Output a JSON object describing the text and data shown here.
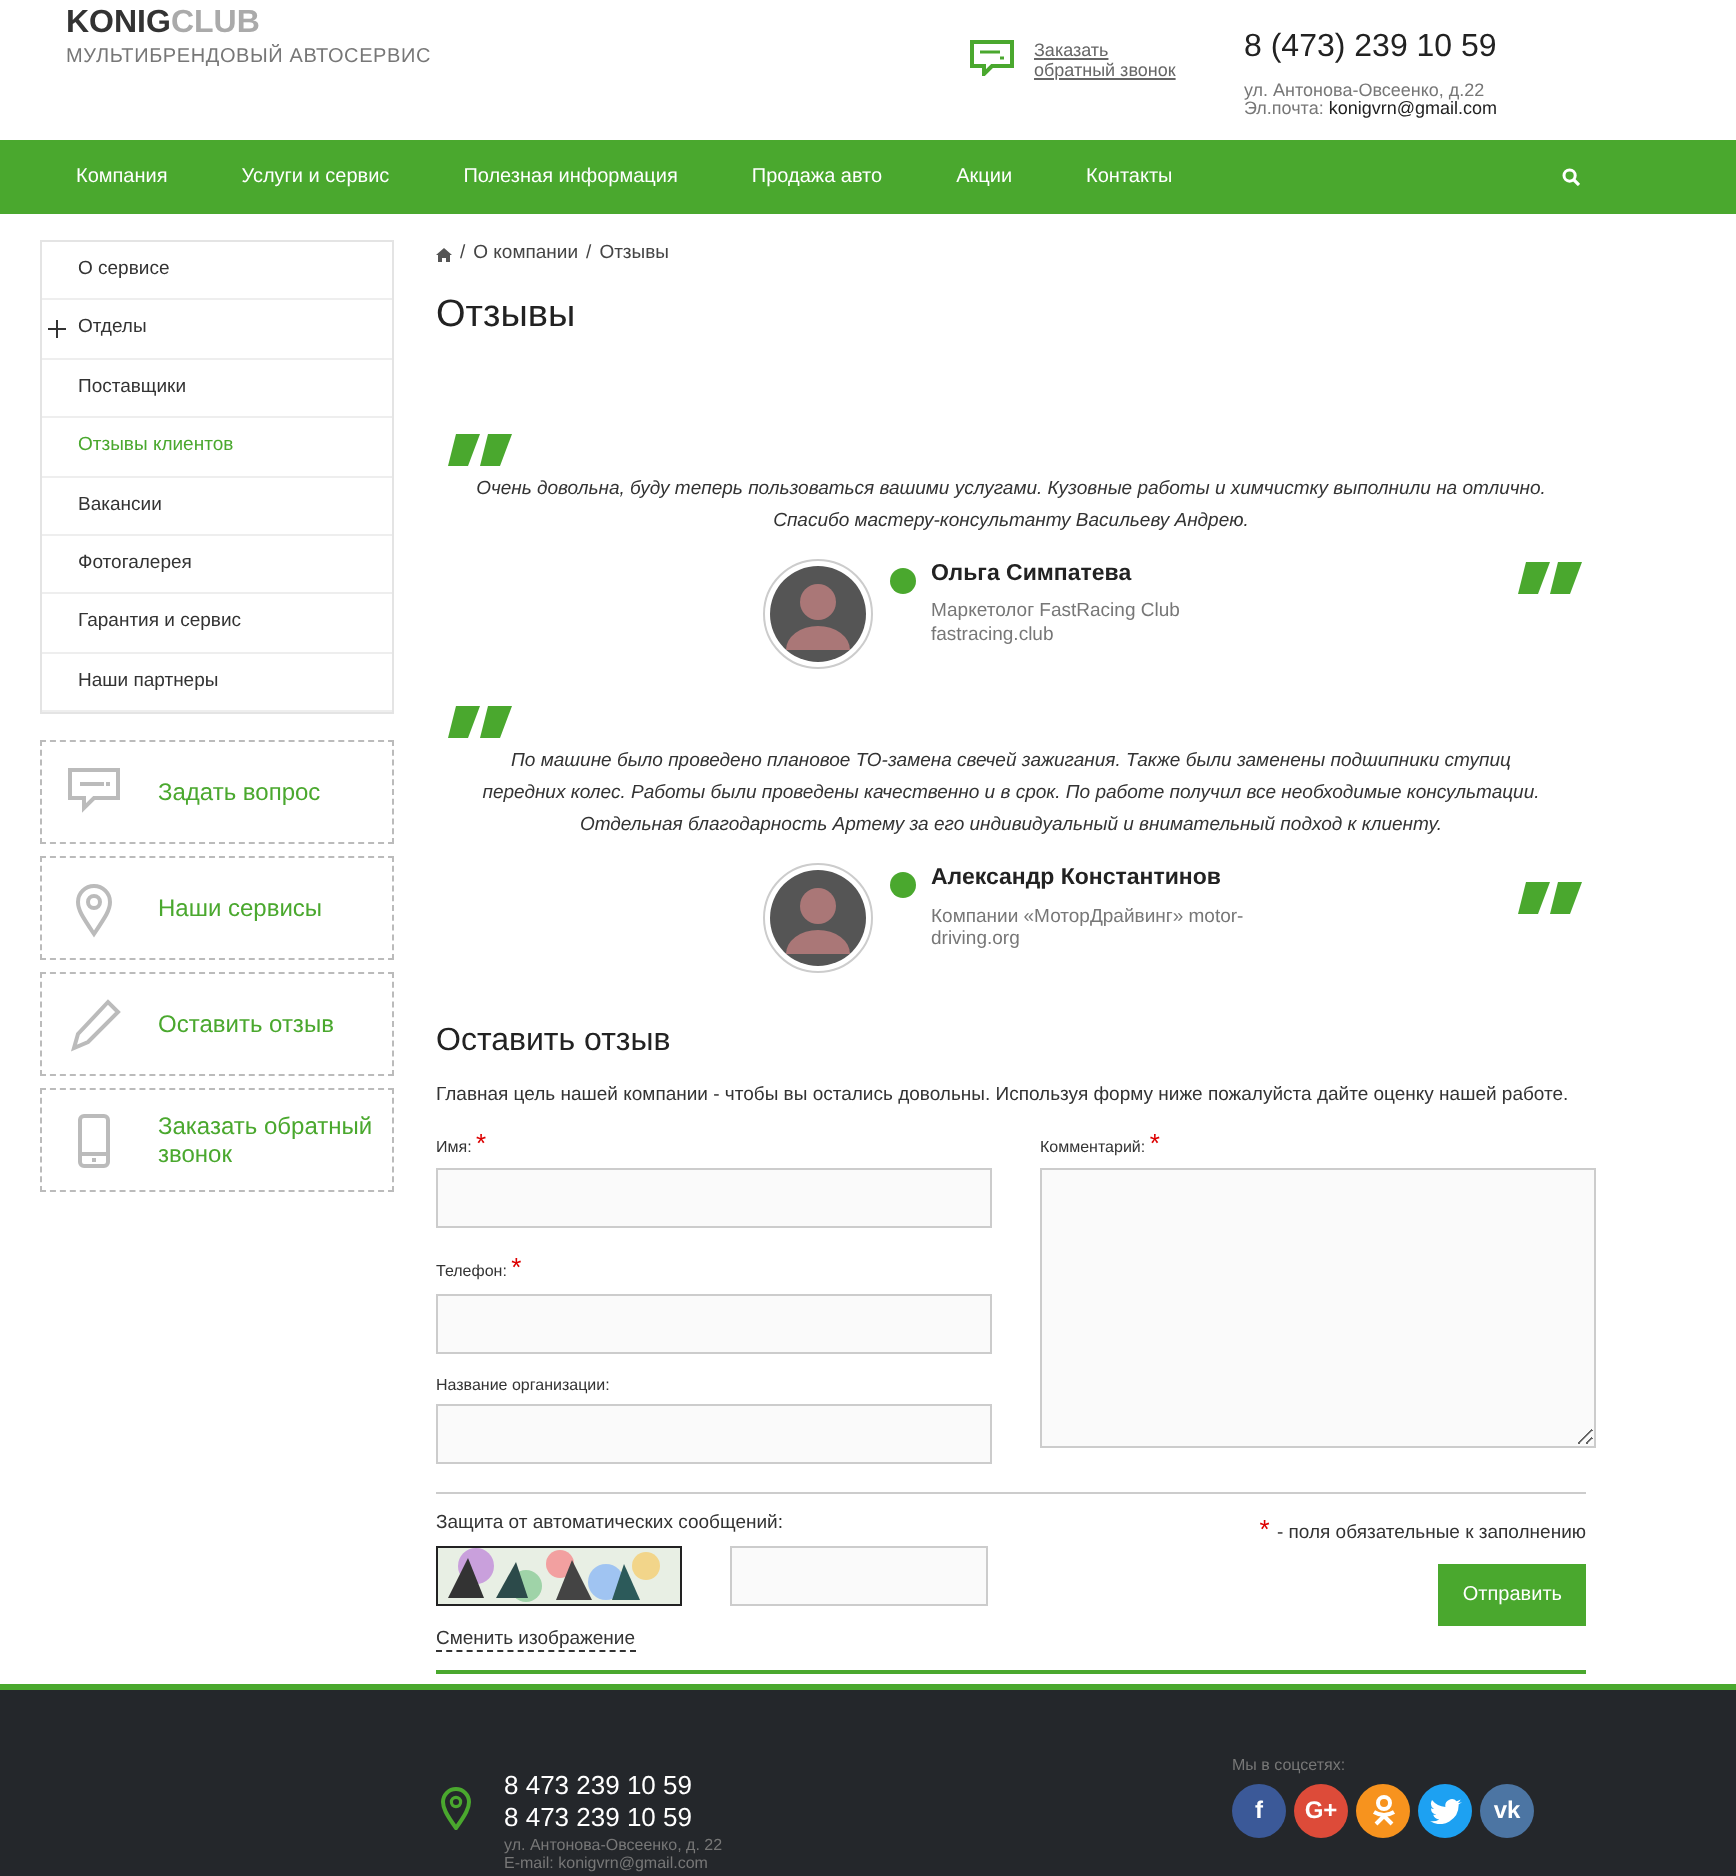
{
  "logo": {
    "brand_dark": "KONIG",
    "brand_light": "CLUB",
    "tagline": "МУЛЬТИБРЕНДОВЫЙ АВТОСЕРВИС"
  },
  "callback": {
    "line1": "Заказать",
    "line2": "обратный звонок"
  },
  "contacts": {
    "phone": "8 (473) 239 10 59",
    "address": "ул. Антонова-Овсеенко, д.22",
    "email_label": "Эл.почта:",
    "email": "konigvrn@gmail.com"
  },
  "nav": [
    "Компания",
    "Услуги и сервис",
    "Полезная информация",
    "Продажа авто",
    "Акции",
    "Контакты"
  ],
  "sidebar": {
    "items": [
      {
        "label": "О сервисе",
        "selected": false,
        "expandable": false
      },
      {
        "label": "Отделы",
        "selected": false,
        "expandable": true
      },
      {
        "label": "Поставщики",
        "selected": false,
        "expandable": false
      },
      {
        "label": "Отзывы клиентов",
        "selected": true,
        "expandable": false
      },
      {
        "label": "Вакансии",
        "selected": false,
        "expandable": false
      },
      {
        "label": "Фотогалерея",
        "selected": false,
        "expandable": false
      },
      {
        "label": "Гарантия и сервис",
        "selected": false,
        "expandable": false
      },
      {
        "label": "Наши партнеры",
        "selected": false,
        "expandable": false
      }
    ],
    "actions": [
      {
        "kind": "chat",
        "label": "Задать вопрос"
      },
      {
        "kind": "pin",
        "label": "Наши сервисы"
      },
      {
        "kind": "pencil",
        "label": "Оставить отзыв"
      },
      {
        "kind": "phone",
        "label": "Заказать обратный звонок"
      }
    ]
  },
  "breadcrumb": [
    "О компании",
    "Отзывы"
  ],
  "breadcrumb_separator": "/",
  "title": "Отзывы",
  "reviews": [
    {
      "text": "Очень довольна, буду теперь пользоваться вашими услугами. Кузовные работы и химчистку выполнили на отлично. Спасибо мастеру-консультанту Васильеву Андрею.",
      "name": "Ольга Симпатева",
      "role": "Маркетолог FastRacing Club fastracing.club"
    },
    {
      "text": "По машине было проведено плановое ТО-замена свечей зажигания. Также были заменены подшипники ступиц передних колес. Работы были проведены качественно и в срок. По работе получил все необходимые консультации. Отдельная благодарность Артему за его индивидуальный и внимательный подход к клиенту.",
      "name": "Александр Константинов",
      "role": "Компании «МоторДрайвинг» motor-driving.org"
    }
  ],
  "form": {
    "title": "Оставить отзыв",
    "required_mark": "*",
    "intro": "Главная цель нашей компании - чтобы вы остались довольны. Используя форму ниже пожалуйста дайте оценку нашей работе.",
    "fields": [
      {
        "label": "Имя:",
        "required": true
      },
      {
        "label": "Телефон:",
        "required": true
      },
      {
        "label": "Название организации:",
        "required": false
      }
    ],
    "comment": {
      "label": "Комментарий:",
      "required": true
    },
    "captcha_label": "Защита от автоматических сообщений:",
    "required_note": "- поля обязательные к заполнению",
    "change_image": "Сменить изображение",
    "submit": "Отправить"
  },
  "footer": {
    "phones": [
      "8 473 239 10 59",
      "8 473 239 10 59"
    ],
    "address": "ул. Антонова-Овсеенко, д. 22",
    "email": "E-mail: konigvrn@gmail.com",
    "social_title": "Мы в соцсетях:",
    "social": [
      {
        "kind": "text",
        "label": "f",
        "color": "#3b5998"
      },
      {
        "kind": "text",
        "label": "G+",
        "color": "#dd4b39"
      },
      {
        "kind": "ok",
        "color": "#f7931e"
      },
      {
        "kind": "bird",
        "color": "#1da1f2"
      },
      {
        "kind": "text",
        "label": "vk",
        "color": "#4c75a3"
      }
    ]
  }
}
